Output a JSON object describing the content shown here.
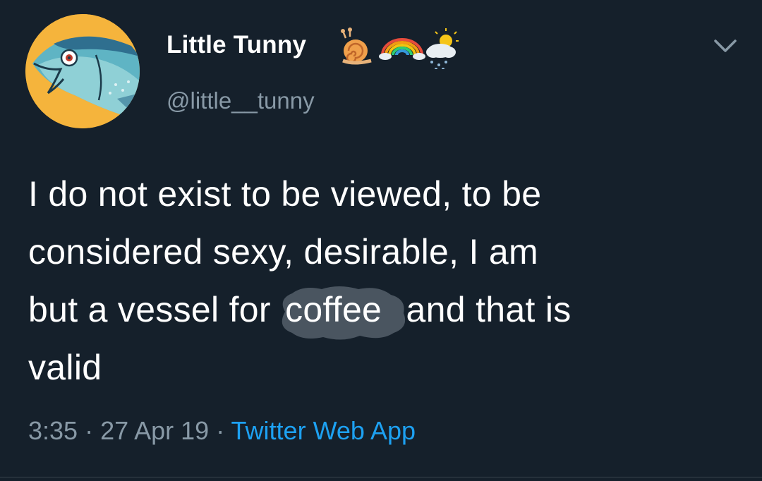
{
  "tweet": {
    "display_name": "Little Tunny",
    "handle": "@little__tunny",
    "text_lines": [
      "I do not exist to be viewed, to be",
      "considered sexy, desirable, I am"
    ],
    "line3_before": "but a vessel for ",
    "highlight_word": "coffee",
    "line3_after": ", and that is",
    "line4": "valid",
    "time": "3:35",
    "separator": " · ",
    "date": "27 Apr 19",
    "source": "Twitter Web App"
  },
  "icons": {
    "name_emojis": [
      "snail-icon",
      "rainbow-icon",
      "sun-behind-rain-cloud-icon"
    ],
    "menu": "chevron-down-icon"
  },
  "colors": {
    "background": "#15202b",
    "primary_text": "#ffffff",
    "secondary_text": "#8899a6",
    "link": "#1da1f2",
    "avatar_bg": "#f5b43c"
  }
}
